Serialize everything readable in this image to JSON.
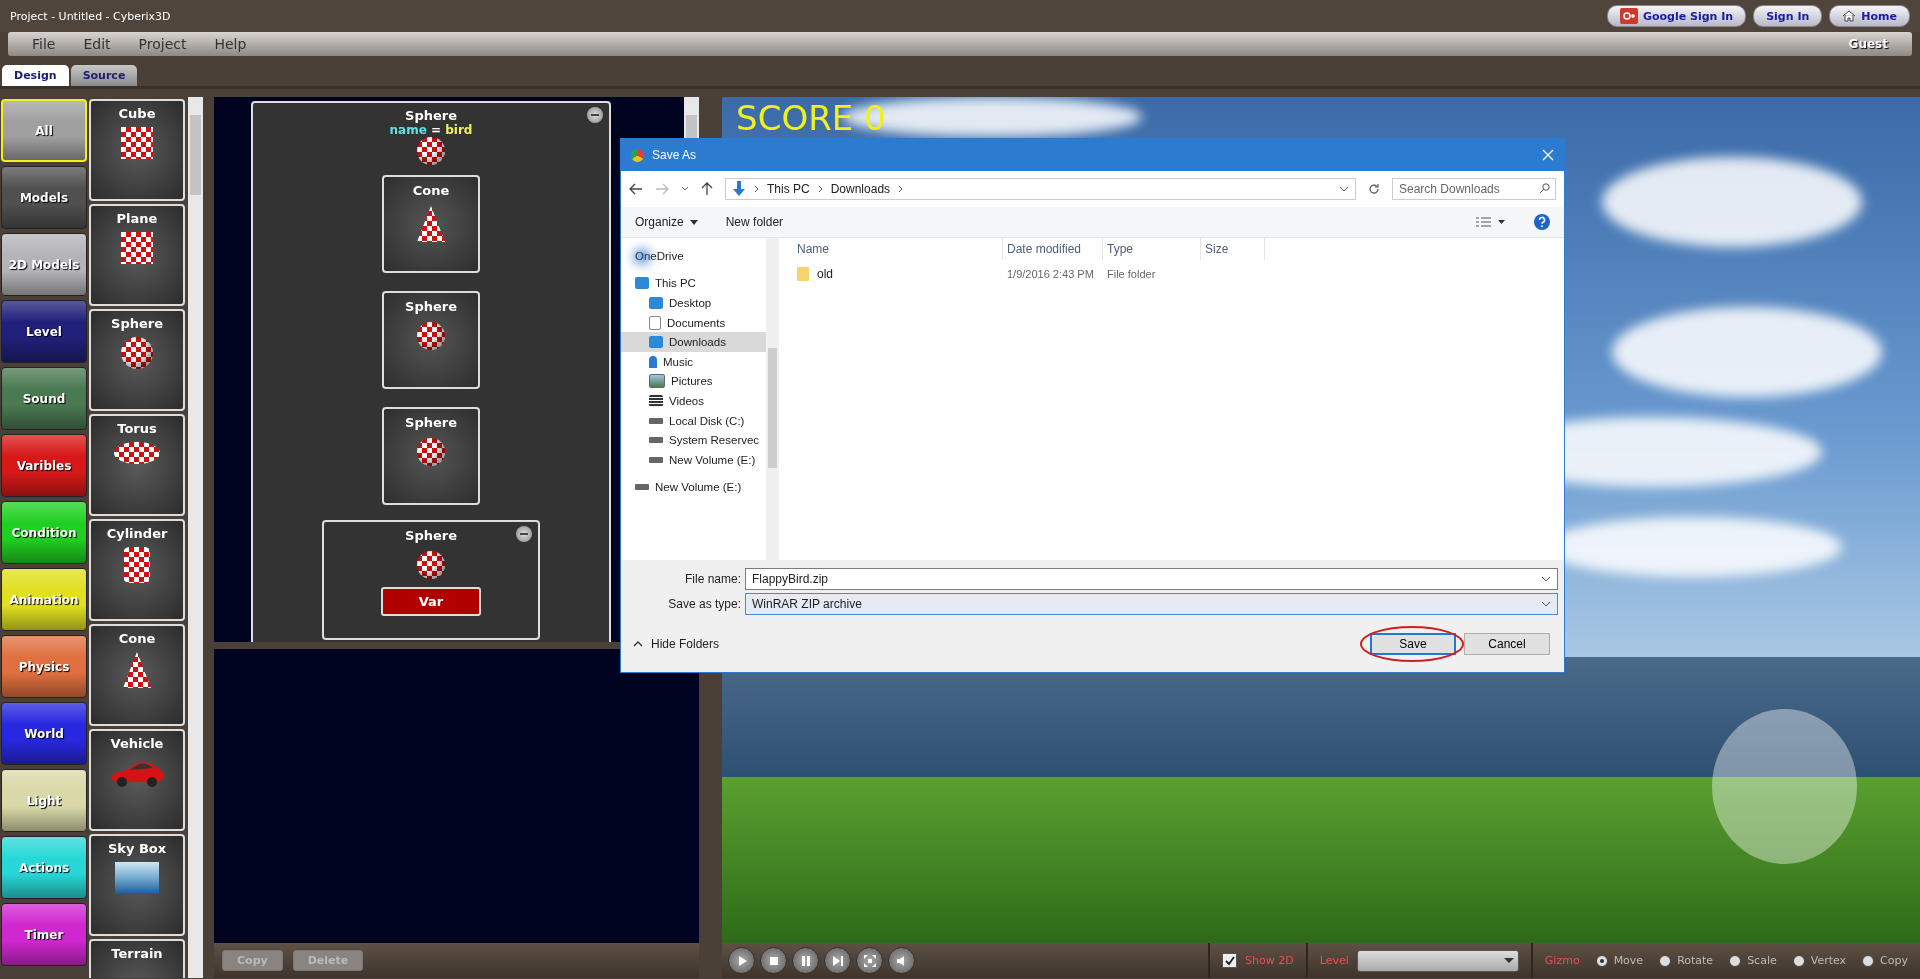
{
  "window": {
    "title": "Project - Untitled - Cyberix3D"
  },
  "header_buttons": [
    {
      "label": "Google Sign In",
      "kind": "google"
    },
    {
      "label": "Sign In",
      "kind": "plain"
    },
    {
      "label": "Home",
      "kind": "home"
    }
  ],
  "menu": [
    "File",
    "Edit",
    "Project",
    "Help"
  ],
  "user": "Guest",
  "tabs": [
    {
      "label": "Design",
      "selected": true
    },
    {
      "label": "Source",
      "selected": false
    }
  ],
  "categories": [
    {
      "label": "All",
      "color": "#a0a0a0",
      "selected": true
    },
    {
      "label": "Models",
      "color": "#505050",
      "selected": false
    },
    {
      "label": "2D Models",
      "color": "#b4b4b8",
      "selected": false
    },
    {
      "label": "Level",
      "color": "#20207a",
      "selected": false
    },
    {
      "label": "Sound",
      "color": "#4a7a52",
      "selected": false
    },
    {
      "label": "Varibles",
      "color": "#d81818",
      "selected": false
    },
    {
      "label": "Condition",
      "color": "#20d020",
      "selected": false
    },
    {
      "label": "Animation",
      "color": "#e0e020",
      "selected": false
    },
    {
      "label": "Physics",
      "color": "#e07040",
      "selected": false
    },
    {
      "label": "World",
      "color": "#2828e0",
      "selected": false
    },
    {
      "label": "Light",
      "color": "#d8d8a8",
      "selected": false
    },
    {
      "label": "Actions",
      "color": "#28d8d8",
      "selected": false
    },
    {
      "label": "Timer",
      "color": "#d028d0",
      "selected": false
    }
  ],
  "palette": [
    {
      "label": "Cube",
      "kind": "cube"
    },
    {
      "label": "Plane",
      "kind": "plane"
    },
    {
      "label": "Sphere",
      "kind": "sphere"
    },
    {
      "label": "Torus",
      "kind": "torus"
    },
    {
      "label": "Cylinder",
      "kind": "cylinder"
    },
    {
      "label": "Cone",
      "kind": "cone"
    },
    {
      "label": "Vehicle",
      "kind": "vehicle"
    },
    {
      "label": "Sky Box",
      "kind": "skybox"
    },
    {
      "label": "Terrain",
      "kind": "terrain"
    }
  ],
  "script": {
    "title": "Sphere",
    "property": {
      "name": "name",
      "operator": "=",
      "value": "bird"
    },
    "children": [
      {
        "title": "Cone",
        "kind": "cone"
      },
      {
        "title": "Sphere",
        "kind": "sphere"
      },
      {
        "title": "Sphere",
        "kind": "sphere"
      }
    ],
    "next": {
      "title": "Sphere",
      "kind": "sphere",
      "block": "Var"
    }
  },
  "script_buttons": [
    {
      "label": "Copy",
      "disabled": true
    },
    {
      "label": "Delete",
      "disabled": true
    }
  ],
  "viewport": {
    "score_label": "SCORE",
    "score": "0"
  },
  "playback_controls": [
    {
      "kind": "play"
    },
    {
      "kind": "stop"
    },
    {
      "kind": "pause"
    },
    {
      "kind": "step"
    },
    {
      "kind": "fit"
    },
    {
      "kind": "sound"
    }
  ],
  "show_2d": {
    "label": "Show 2D",
    "checked": true
  },
  "level": {
    "label": "Level"
  },
  "gizmo": {
    "label": "Gizmo",
    "options": [
      {
        "label": "Move",
        "selected": true
      },
      {
        "label": "Rotate",
        "selected": false
      },
      {
        "label": "Scale",
        "selected": false
      },
      {
        "label": "Vertex",
        "selected": false
      },
      {
        "label": "Copy",
        "selected": false
      }
    ]
  },
  "dialog": {
    "title": "Save As",
    "breadcrumb": [
      "This PC",
      "Downloads"
    ],
    "search": {
      "placeholder": "Search Downloads"
    },
    "toolbar": [
      "Organize",
      "New folder"
    ],
    "nav": [
      {
        "label": "OneDrive",
        "kind": "cloud",
        "selected": false
      },
      {
        "label": "This PC",
        "kind": "computer",
        "selected": false,
        "children": [
          {
            "label": "Desktop",
            "kind": "desktop",
            "selected": false
          },
          {
            "label": "Documents",
            "kind": "document",
            "selected": false
          },
          {
            "label": "Downloads",
            "kind": "download",
            "selected": true
          },
          {
            "label": "Music",
            "kind": "music",
            "selected": false
          },
          {
            "label": "Pictures",
            "kind": "picture",
            "selected": false
          },
          {
            "label": "Videos",
            "kind": "video",
            "selected": false
          },
          {
            "label": "Local Disk (C:)",
            "kind": "disk",
            "selected": false
          },
          {
            "label": "System Reservec",
            "kind": "drive",
            "selected": false
          },
          {
            "label": "New Volume (E:)",
            "kind": "drive",
            "selected": false
          }
        ]
      },
      {
        "label": "New Volume (E:)",
        "kind": "drive",
        "selected": false
      }
    ],
    "columns": [
      "Name",
      "Date modified",
      "Type",
      "Size"
    ],
    "rows": [
      {
        "name": "old",
        "date": "1/9/2016 2:43 PM",
        "type": "File folder"
      }
    ],
    "file_name": {
      "label": "File name:",
      "value": "FlappyBird.zip"
    },
    "save_type": {
      "label": "Save as type:",
      "value": "WinRAR ZIP archive"
    },
    "hide_folders": "Hide Folders",
    "buttons": [
      {
        "label": "Save",
        "highlighted": true
      },
      {
        "label": "Cancel",
        "highlighted": false
      }
    ]
  }
}
